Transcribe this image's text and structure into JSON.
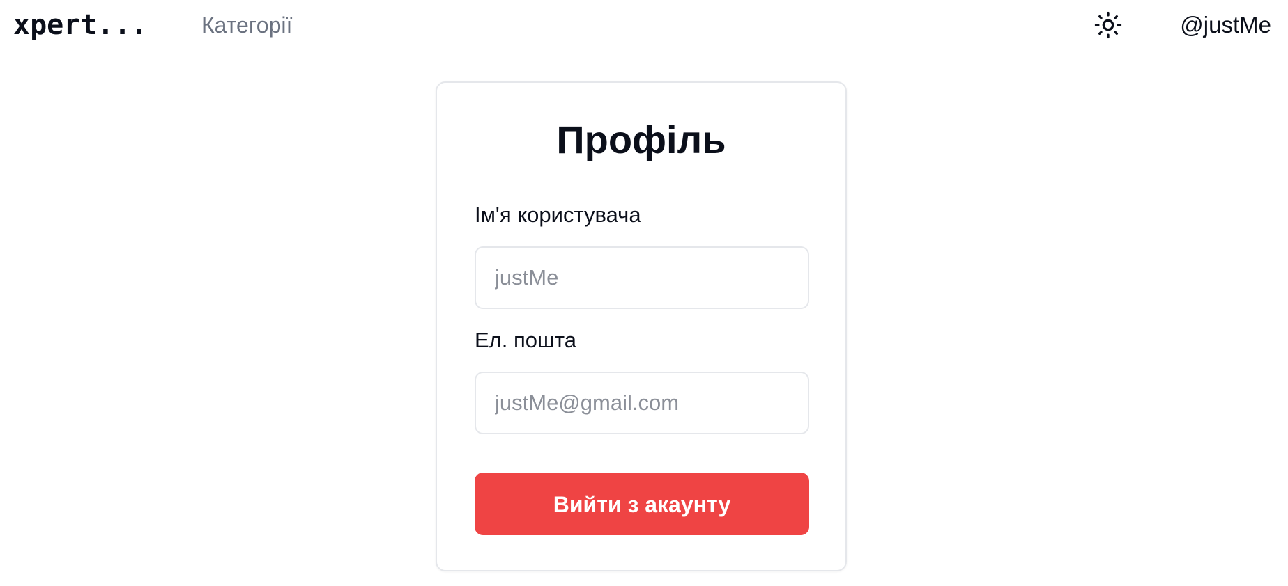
{
  "header": {
    "logo": "xpert...",
    "nav_categories": "Категорії",
    "theme_icon": "sun-icon",
    "user_handle": "@justMe"
  },
  "profile": {
    "title": "Профіль",
    "username_label": "Ім'я користувача",
    "username_placeholder": "justMe",
    "email_label": "Ел. пошта",
    "email_placeholder": "justMe@gmail.com",
    "logout_label": "Вийти з акаунту"
  },
  "colors": {
    "danger": "#ef4444",
    "muted_text": "#6b7280",
    "border": "#e5e7eb"
  }
}
